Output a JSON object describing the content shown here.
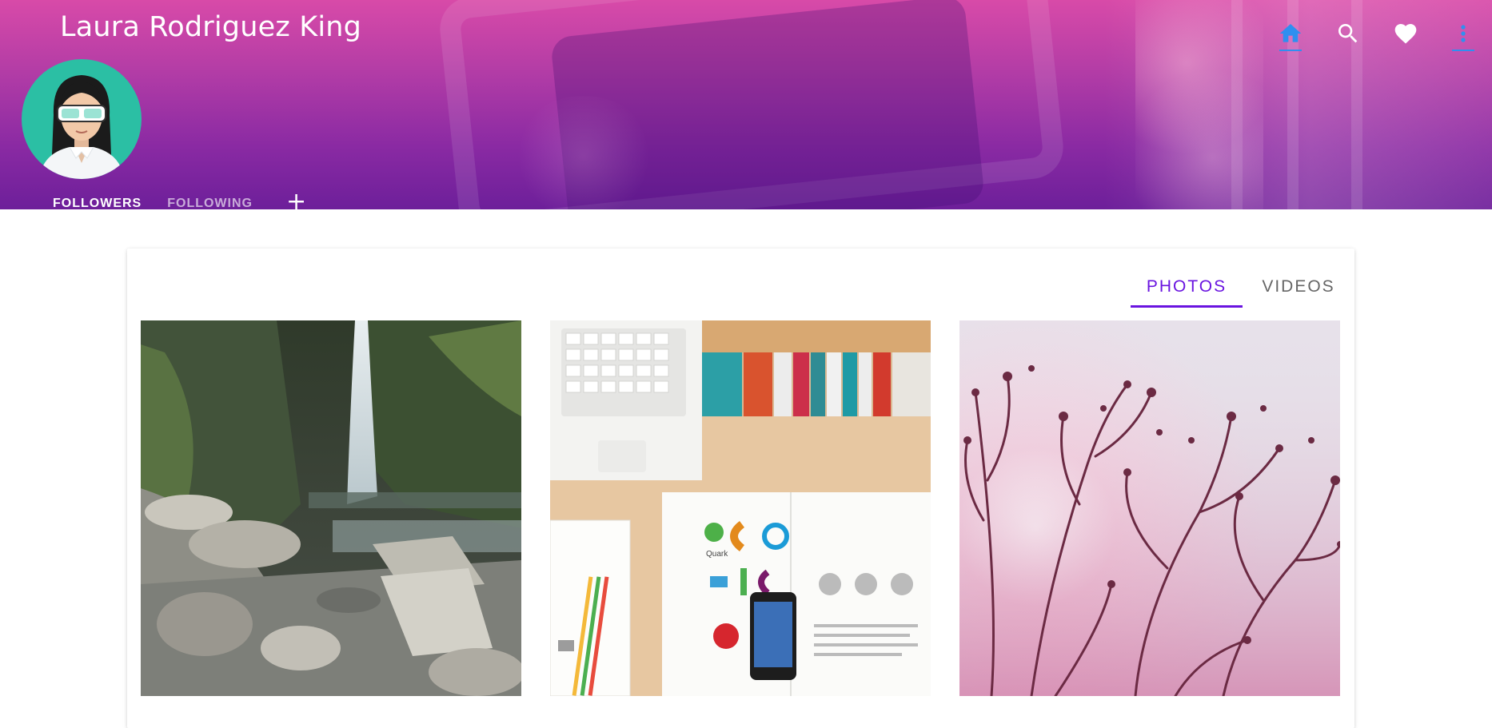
{
  "header": {
    "profile_name": "Laura Rodriguez King",
    "actions": [
      {
        "icon": "home-icon",
        "active": true
      },
      {
        "icon": "search-icon"
      },
      {
        "icon": "heart-icon"
      },
      {
        "icon": "more-vert-icon"
      }
    ],
    "tabs": {
      "followers": "FOLLOWERS",
      "following": "FOLLOWING",
      "add": "+"
    }
  },
  "media": {
    "tabs": [
      {
        "label": "PHOTOS",
        "active": true
      },
      {
        "label": "VIDEOS",
        "active": false
      }
    ],
    "photos": [
      {
        "subject": "waterfall-rocks"
      },
      {
        "subject": "desk-laptop-books"
      },
      {
        "subject": "pink-branches"
      }
    ]
  },
  "colors": {
    "accent": "#6a14e0",
    "banner_top": "#d84aa8",
    "banner_bottom": "#6d1f9a",
    "avatar_bg": "#2bbfa4",
    "home_icon": "#2f8ff0"
  }
}
